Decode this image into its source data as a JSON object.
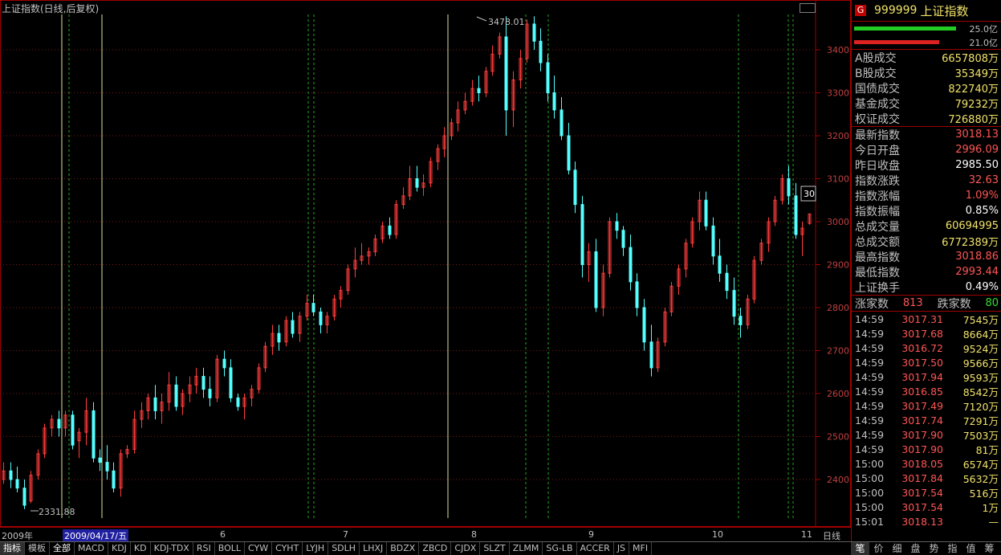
{
  "chart_title": "上证指数(日线,后复权)",
  "chart_data": {
    "type": "candlestick",
    "title": "上证指数(日线,后复权)",
    "ylim": [
      2300,
      3500
    ],
    "yticks": [
      2400,
      2500,
      2600,
      2700,
      2800,
      2900,
      3000,
      3100,
      3200,
      3300,
      3400
    ],
    "annotations": {
      "high_label": "3478.01",
      "low_label": "2331.88",
      "last_label": "30"
    },
    "x_labels": [
      "2009年",
      "2009/04/17/五",
      "6",
      "7",
      "8",
      "9",
      "10",
      "11",
      "日线"
    ],
    "candles": [
      [
        2400,
        2440,
        2390,
        2420
      ],
      [
        2420,
        2440,
        2380,
        2400
      ],
      [
        2400,
        2430,
        2370,
        2380
      ],
      [
        2380,
        2400,
        2331,
        2340
      ],
      [
        2350,
        2420,
        2345,
        2410
      ],
      [
        2410,
        2470,
        2400,
        2460
      ],
      [
        2460,
        2530,
        2450,
        2520
      ],
      [
        2520,
        2550,
        2500,
        2540
      ],
      [
        2540,
        2560,
        2500,
        2520
      ],
      [
        2520,
        2560,
        2500,
        2550
      ],
      [
        2550,
        2560,
        2470,
        2480
      ],
      [
        2490,
        2520,
        2450,
        2510
      ],
      [
        2510,
        2590,
        2480,
        2560
      ],
      [
        2560,
        2580,
        2440,
        2450
      ],
      [
        2450,
        2470,
        2420,
        2440
      ],
      [
        2440,
        2480,
        2400,
        2420
      ],
      [
        2420,
        2440,
        2370,
        2380
      ],
      [
        2380,
        2470,
        2360,
        2460
      ],
      [
        2460,
        2480,
        2450,
        2470
      ],
      [
        2470,
        2560,
        2460,
        2540
      ],
      [
        2540,
        2580,
        2520,
        2560
      ],
      [
        2560,
        2600,
        2540,
        2590
      ],
      [
        2590,
        2620,
        2540,
        2560
      ],
      [
        2560,
        2600,
        2530,
        2580
      ],
      [
        2580,
        2650,
        2560,
        2620
      ],
      [
        2620,
        2640,
        2560,
        2570
      ],
      [
        2570,
        2610,
        2550,
        2600
      ],
      [
        2600,
        2640,
        2580,
        2620
      ],
      [
        2620,
        2660,
        2600,
        2640
      ],
      [
        2640,
        2660,
        2590,
        2610
      ],
      [
        2610,
        2640,
        2570,
        2590
      ],
      [
        2590,
        2690,
        2580,
        2680
      ],
      [
        2680,
        2700,
        2640,
        2660
      ],
      [
        2660,
        2680,
        2580,
        2590
      ],
      [
        2590,
        2600,
        2560,
        2570
      ],
      [
        2570,
        2600,
        2540,
        2590
      ],
      [
        2590,
        2620,
        2570,
        2610
      ],
      [
        2610,
        2670,
        2600,
        2660
      ],
      [
        2660,
        2720,
        2650,
        2710
      ],
      [
        2710,
        2760,
        2690,
        2740
      ],
      [
        2740,
        2760,
        2700,
        2720
      ],
      [
        2720,
        2780,
        2710,
        2770
      ],
      [
        2770,
        2790,
        2730,
        2740
      ],
      [
        2740,
        2790,
        2720,
        2780
      ],
      [
        2780,
        2830,
        2770,
        2810
      ],
      [
        2810,
        2830,
        2780,
        2790
      ],
      [
        2790,
        2800,
        2740,
        2760
      ],
      [
        2760,
        2790,
        2740,
        2780
      ],
      [
        2780,
        2830,
        2770,
        2820
      ],
      [
        2820,
        2850,
        2800,
        2840
      ],
      [
        2840,
        2900,
        2830,
        2890
      ],
      [
        2890,
        2940,
        2870,
        2910
      ],
      [
        2910,
        2950,
        2900,
        2920
      ],
      [
        2920,
        2940,
        2900,
        2930
      ],
      [
        2930,
        2970,
        2920,
        2960
      ],
      [
        2960,
        3000,
        2950,
        2990
      ],
      [
        2990,
        3010,
        2960,
        2970
      ],
      [
        2970,
        3050,
        2960,
        3040
      ],
      [
        3040,
        3080,
        3030,
        3060
      ],
      [
        3060,
        3130,
        3050,
        3100
      ],
      [
        3100,
        3130,
        3070,
        3080
      ],
      [
        3080,
        3110,
        3060,
        3090
      ],
      [
        3090,
        3150,
        3080,
        3140
      ],
      [
        3140,
        3180,
        3120,
        3170
      ],
      [
        3170,
        3220,
        3150,
        3200
      ],
      [
        3200,
        3240,
        3190,
        3230
      ],
      [
        3230,
        3280,
        3210,
        3260
      ],
      [
        3260,
        3300,
        3250,
        3280
      ],
      [
        3280,
        3330,
        3270,
        3310
      ],
      [
        3310,
        3340,
        3280,
        3300
      ],
      [
        3300,
        3360,
        3290,
        3350
      ],
      [
        3350,
        3410,
        3340,
        3390
      ],
      [
        3390,
        3440,
        3380,
        3430
      ],
      [
        3430,
        3478,
        3200,
        3260
      ],
      [
        3260,
        3350,
        3220,
        3330
      ],
      [
        3330,
        3400,
        3310,
        3380
      ],
      [
        3380,
        3470,
        3370,
        3460
      ],
      [
        3460,
        3478,
        3400,
        3420
      ],
      [
        3420,
        3450,
        3350,
        3370
      ],
      [
        3370,
        3390,
        3280,
        3300
      ],
      [
        3300,
        3340,
        3240,
        3260
      ],
      [
        3260,
        3290,
        3190,
        3200
      ],
      [
        3200,
        3230,
        3110,
        3120
      ],
      [
        3120,
        3140,
        3020,
        3040
      ],
      [
        3040,
        3060,
        2870,
        2900
      ],
      [
        2900,
        2950,
        2860,
        2930
      ],
      [
        2930,
        2960,
        2790,
        2800
      ],
      [
        2800,
        2900,
        2780,
        2880
      ],
      [
        2880,
        3010,
        2870,
        3000
      ],
      [
        3000,
        3020,
        2960,
        2980
      ],
      [
        2980,
        2990,
        2920,
        2940
      ],
      [
        2940,
        2970,
        2840,
        2860
      ],
      [
        2860,
        2880,
        2780,
        2800
      ],
      [
        2800,
        2820,
        2700,
        2720
      ],
      [
        2720,
        2760,
        2640,
        2660
      ],
      [
        2660,
        2730,
        2650,
        2720
      ],
      [
        2720,
        2800,
        2710,
        2790
      ],
      [
        2790,
        2860,
        2780,
        2850
      ],
      [
        2850,
        2900,
        2830,
        2890
      ],
      [
        2890,
        2960,
        2870,
        2950
      ],
      [
        2950,
        3010,
        2940,
        3000
      ],
      [
        3000,
        3070,
        2980,
        3050
      ],
      [
        3050,
        3070,
        2980,
        2990
      ],
      [
        2990,
        3010,
        2900,
        2920
      ],
      [
        2920,
        2960,
        2860,
        2880
      ],
      [
        2880,
        2900,
        2820,
        2840
      ],
      [
        2840,
        2870,
        2760,
        2780
      ],
      [
        2780,
        2800,
        2730,
        2760
      ],
      [
        2760,
        2830,
        2750,
        2820
      ],
      [
        2820,
        2920,
        2810,
        2910
      ],
      [
        2910,
        2960,
        2900,
        2950
      ],
      [
        2950,
        3010,
        2930,
        3000
      ],
      [
        3000,
        3060,
        2990,
        3050
      ],
      [
        3050,
        3110,
        3040,
        3100
      ],
      [
        3100,
        3130,
        3040,
        3060
      ],
      [
        3060,
        3090,
        2960,
        2970
      ],
      [
        2970,
        3000,
        2920,
        2985
      ],
      [
        2996,
        3018,
        2993,
        3018
      ]
    ]
  },
  "price_labels": [
    "3400",
    "3300",
    "3200",
    "3100",
    "3000",
    "2900",
    "2800",
    "2700",
    "2600",
    "2500",
    "2400"
  ],
  "panel": {
    "badge": "G",
    "code": "999999",
    "name": "上证指数",
    "bar_top_value": "25.0亿",
    "bar_bottom_value": "21.0亿",
    "bar_top_color": "#22cc22",
    "bar_bottom_color": "#dd2222",
    "bar_top_fraction": 0.91,
    "bar_bottom_fraction": 0.76,
    "vol_rows": [
      {
        "label": "A股成交",
        "value": "6657808万"
      },
      {
        "label": "B股成交",
        "value": "35349万"
      },
      {
        "label": "国债成交",
        "value": "822740万"
      },
      {
        "label": "基金成交",
        "value": "79232万"
      },
      {
        "label": "权证成交",
        "value": "726880万"
      }
    ],
    "stat_rows": [
      {
        "label": "最新指数",
        "value": "3018.13",
        "color": "red"
      },
      {
        "label": "今日开盘",
        "value": "2996.09",
        "color": "red"
      },
      {
        "label": "昨日收盘",
        "value": "2985.50",
        "color": "wht"
      },
      {
        "label": "指数涨跌",
        "value": "32.63",
        "color": "red"
      },
      {
        "label": "指数涨幅",
        "value": "1.09%",
        "color": "red"
      },
      {
        "label": "指数振幅",
        "value": "0.85%",
        "color": "wht"
      },
      {
        "label": "总成交量",
        "value": "60694995",
        "color": "yel"
      },
      {
        "label": "总成交额",
        "value": "6772389万",
        "color": "yel"
      },
      {
        "label": "最高指数",
        "value": "3018.86",
        "color": "red"
      },
      {
        "label": "最低指数",
        "value": "2993.44",
        "color": "red"
      },
      {
        "label": "上证换手",
        "value": "0.49%",
        "color": "wht"
      }
    ],
    "up_label": "涨家数",
    "up_count": "813",
    "down_label": "跌家数",
    "down_count": "80",
    "ticks": [
      {
        "time": "14:59",
        "price": "3017.31",
        "vol": "7545万"
      },
      {
        "time": "14:59",
        "price": "3017.68",
        "vol": "8664万"
      },
      {
        "time": "14:59",
        "price": "3016.72",
        "vol": "9524万"
      },
      {
        "time": "14:59",
        "price": "3017.50",
        "vol": "9566万"
      },
      {
        "time": "14:59",
        "price": "3017.94",
        "vol": "9593万"
      },
      {
        "time": "14:59",
        "price": "3016.85",
        "vol": "8542万"
      },
      {
        "time": "14:59",
        "price": "3017.49",
        "vol": "7120万"
      },
      {
        "time": "14:59",
        "price": "3017.74",
        "vol": "7291万"
      },
      {
        "time": "14:59",
        "price": "3017.90",
        "vol": "7503万"
      },
      {
        "time": "14:59",
        "price": "3017.90",
        "vol": "81万"
      },
      {
        "time": "15:00",
        "price": "3018.05",
        "vol": "6574万"
      },
      {
        "time": "15:00",
        "price": "3017.84",
        "vol": "5632万"
      },
      {
        "time": "15:00",
        "price": "3017.54",
        "vol": "516万"
      },
      {
        "time": "15:00",
        "price": "3017.54",
        "vol": "1万"
      },
      {
        "time": "15:01",
        "price": "3018.13",
        "vol": "—"
      }
    ]
  },
  "bottom_tabs": [
    "指标",
    "模板",
    "全部",
    "MACD",
    "KDJ",
    "KD",
    "KDJ-TDX",
    "RSI",
    "BOLL",
    "CYW",
    "CYHT",
    "LYJH",
    "SDLH",
    "LHXJ",
    "BDZX",
    "ZBCD",
    "CJDX",
    "SLZT",
    "ZLMM",
    "SG-LB",
    "ACCER",
    "JS",
    "MFI"
  ],
  "right_tabs": [
    "笔",
    "价",
    "细",
    "盘",
    "势",
    "指",
    "值",
    "筹"
  ]
}
